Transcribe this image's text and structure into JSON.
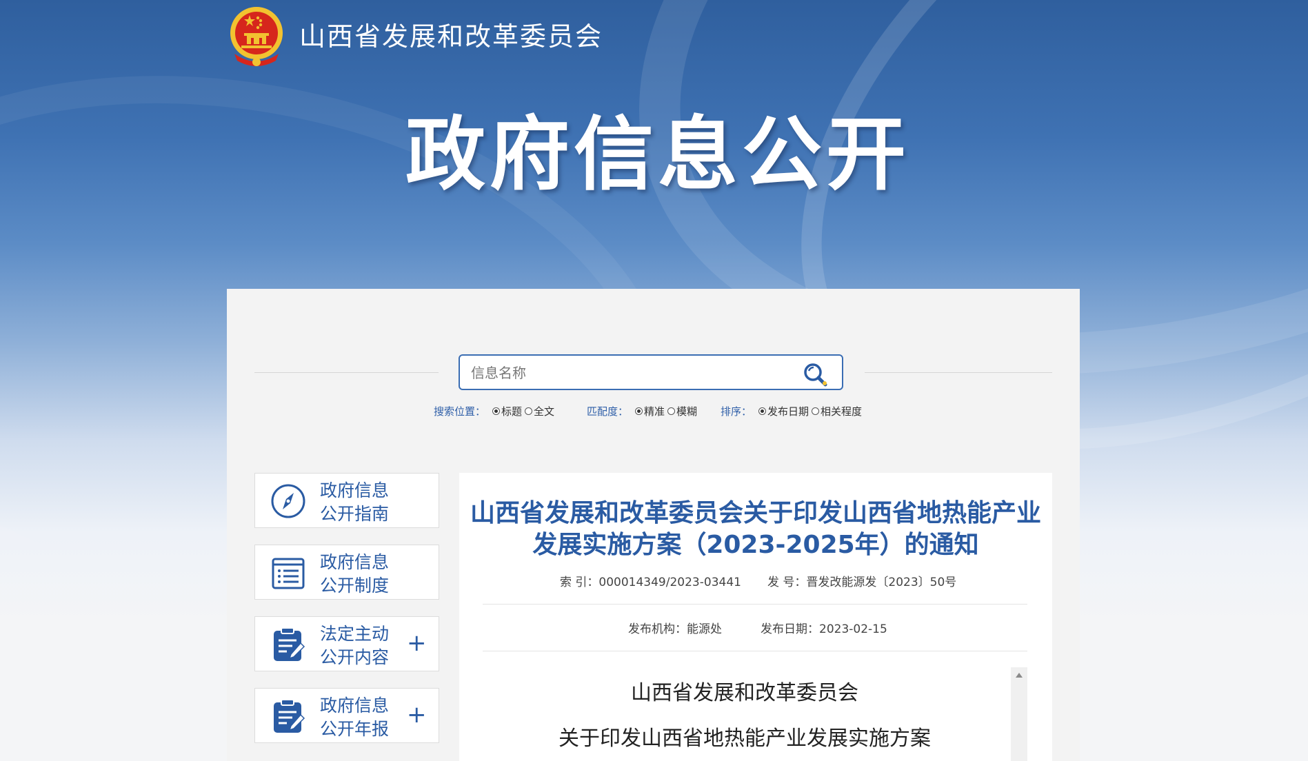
{
  "header": {
    "site_name": "山西省发展和改革委员会",
    "hero_title": "政府信息公开"
  },
  "search": {
    "placeholder": "信息名称",
    "options": {
      "position": {
        "label": "搜索位置：",
        "choices": [
          "标题",
          "全文"
        ],
        "selected": "标题"
      },
      "match": {
        "label": "匹配度：",
        "choices": [
          "精准",
          "模糊"
        ],
        "selected": "精准"
      },
      "sort": {
        "label": "排序：",
        "choices": [
          "发布日期",
          "相关程度"
        ],
        "selected": "发布日期"
      }
    }
  },
  "sidebar": {
    "items": [
      {
        "line1": "政府信息",
        "line2": "公开指南",
        "icon": "compass-icon",
        "expandable": false
      },
      {
        "line1": "政府信息",
        "line2": "公开制度",
        "icon": "list-document-icon",
        "expandable": false
      },
      {
        "line1": "法定主动",
        "line2": "公开内容",
        "icon": "clipboard-edit-icon",
        "expandable": true
      },
      {
        "line1": "政府信息",
        "line2": "公开年报",
        "icon": "clipboard-edit-icon",
        "expandable": true
      }
    ],
    "plus_symbol": "+"
  },
  "article": {
    "title_line1": "山西省发展和改革委员会关于印发山西省地热能产业",
    "title_line2": "发展实施方案（2023-2025年）的通知",
    "index_label": "索 引：",
    "index_value": "000014349/2023-03441",
    "doc_no_label": "发 号：",
    "doc_no_value": "晋发改能源发〔2023〕50号",
    "org_label": "发布机构：",
    "org_value": "能源处",
    "date_label": "发布日期：",
    "date_value": "2023-02-15",
    "body_line1": "山西省发展和改革委员会",
    "body_line2": "关于印发山西省地热能产业发展实施方案"
  },
  "colors": {
    "accent_blue": "#2a5ba3",
    "banner_blue": "#3f72b3",
    "emblem_red": "#d6261c",
    "emblem_gold": "#f2c230"
  }
}
